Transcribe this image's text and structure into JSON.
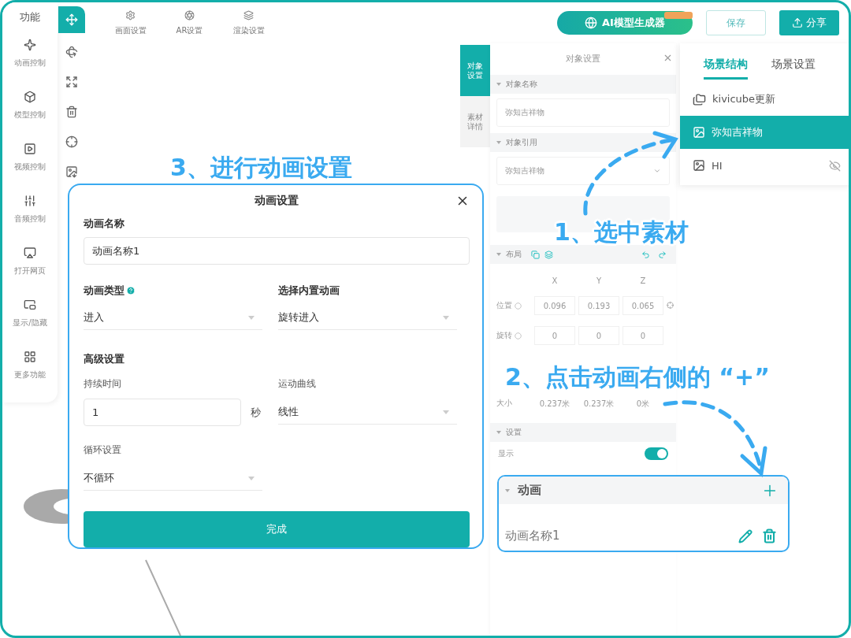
{
  "sidebar": {
    "title": "功能",
    "items": [
      {
        "label": "动画控制"
      },
      {
        "label": "模型控制"
      },
      {
        "label": "视频控制"
      },
      {
        "label": "音频控制"
      },
      {
        "label": "打开网页"
      },
      {
        "label": "显示/隐藏"
      },
      {
        "label": "更多功能"
      }
    ]
  },
  "tools": [
    {
      "selected": true
    },
    {
      "selected": false
    },
    {
      "selected": false
    },
    {
      "selected": false
    },
    {
      "selected": false
    },
    {
      "selected": false
    }
  ],
  "toolbar": {
    "items": [
      {
        "label": "画面设置"
      },
      {
        "label": "AR设置"
      },
      {
        "label": "渲染设置"
      }
    ]
  },
  "header_actions": {
    "ai_button": "AI模型生成器",
    "save_button": "保存",
    "share_button": "分享"
  },
  "side_tabs": [
    {
      "label": "对象设置",
      "selected": true
    },
    {
      "label": "素材详情",
      "selected": false
    }
  ],
  "object_panel": {
    "title": "对象设置",
    "name_section": "对象名称",
    "name_value": "弥知吉祥物",
    "ref_section": "对象引用",
    "ref_value": "弥知吉祥物",
    "layout_section": "布局",
    "axes": [
      "X",
      "Y",
      "Z"
    ],
    "rows": [
      {
        "label": "位置",
        "kind": "input",
        "values": [
          "0.096",
          "0.193",
          "0.065"
        ]
      },
      {
        "label": "旋转",
        "kind": "input",
        "values": [
          "0",
          "0",
          "0"
        ]
      },
      {
        "label": "大小",
        "kind": "text",
        "values": [
          "0.237米",
          "0.237米",
          "0米"
        ]
      }
    ],
    "settings_section": "设置",
    "visible_label": "显示",
    "visible_on": true
  },
  "animation_section": {
    "title": "动画",
    "items": [
      {
        "label": "动画名称1"
      }
    ]
  },
  "scene_panel": {
    "tabs": [
      {
        "label": "场景结构",
        "selected": true
      },
      {
        "label": "场景设置",
        "selected": false
      }
    ],
    "items": [
      {
        "label": "kivicube更新",
        "kind": "folder",
        "selected": false,
        "hidden": false
      },
      {
        "label": "弥知吉祥物",
        "kind": "image",
        "selected": true,
        "hidden": false
      },
      {
        "label": "HI",
        "kind": "image",
        "selected": false,
        "hidden": true
      }
    ]
  },
  "dialog": {
    "title": "动画设置",
    "name_label": "动画名称",
    "name_value": "动画名称1",
    "type_label": "动画类型",
    "type_value": "进入",
    "builtin_label": "选择内置动画",
    "builtin_value": "旋转进入",
    "advanced_title": "高级设置",
    "duration_label": "持续时间",
    "duration_value": "1",
    "duration_unit": "秒",
    "curve_label": "运动曲线",
    "curve_value": "线性",
    "loop_label": "循环设置",
    "loop_value": "不循环",
    "done_button": "完成"
  },
  "annotations": [
    {
      "text": "3、进行动画设置"
    },
    {
      "text": "1、选中素材"
    },
    {
      "text": "2、点击动画右侧的 “+”"
    }
  ]
}
